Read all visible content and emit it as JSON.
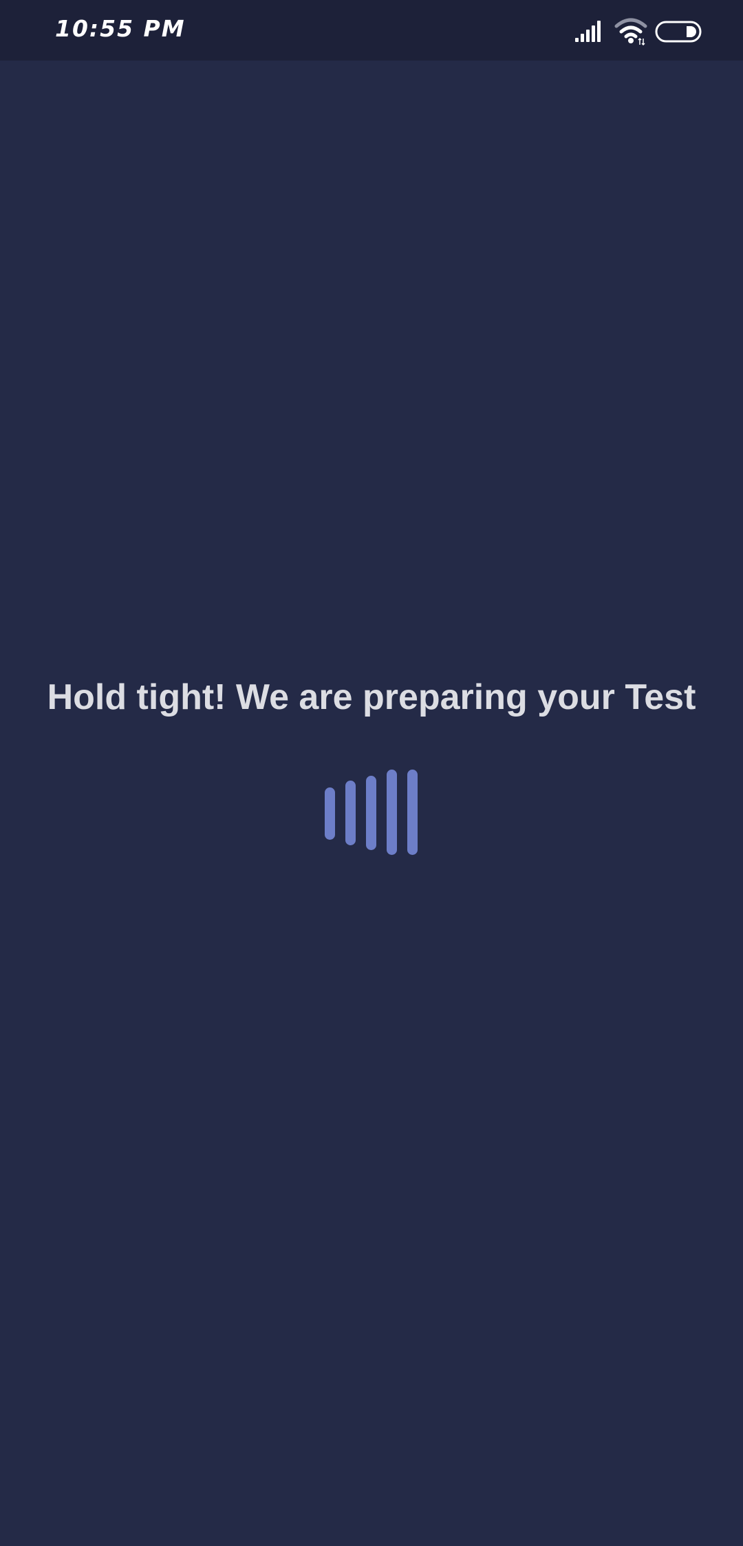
{
  "status_bar": {
    "time": "10:55 PM",
    "icons": [
      "signal-icon",
      "wifi-icon",
      "battery-icon"
    ]
  },
  "loading": {
    "message": "Hold tight! We are preparing your Test",
    "indicator": "loading-bars-icon"
  },
  "colors": {
    "background": "#242a47",
    "status_bar": "#1d2139",
    "text": "#dcdde3",
    "accent": "#6d7ec8"
  }
}
